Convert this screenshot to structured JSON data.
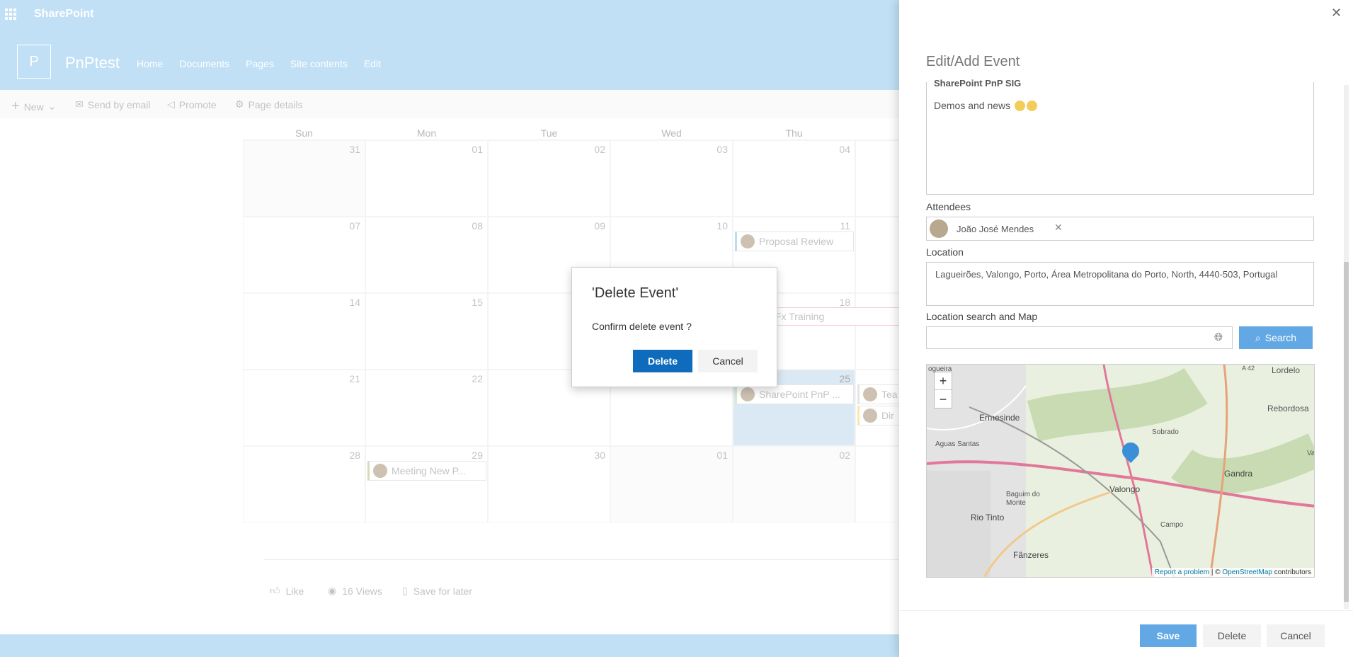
{
  "suite": {
    "brand": "SharePoint"
  },
  "site": {
    "logo_letter": "P",
    "title": "PnPtest",
    "nav": [
      "Home",
      "Documents",
      "Pages",
      "Site contents",
      "Edit"
    ]
  },
  "commands": {
    "new": "New",
    "send": "Send by email",
    "promote": "Promote",
    "details": "Page details"
  },
  "calendar": {
    "weekdays": [
      "Sun",
      "Mon",
      "Tue",
      "Wed",
      "Thu",
      "Fri"
    ],
    "rows": [
      [
        "31",
        "01",
        "02",
        "03",
        "04",
        ""
      ],
      [
        "07",
        "08",
        "09",
        "10",
        "11",
        ""
      ],
      [
        "14",
        "15",
        "",
        "",
        "18",
        ""
      ],
      [
        "21",
        "22",
        "",
        "",
        "25",
        ""
      ],
      [
        "28",
        "29",
        "30",
        "01",
        "02",
        ""
      ]
    ],
    "events": {
      "proposal": "Proposal Review",
      "training": "Fx Training",
      "sharepoint": "SharePoint PnP ...",
      "team": "Tea",
      "dinner": "Dir",
      "meeting": "Meeting New P..."
    }
  },
  "social": {
    "like": "Like",
    "views": "16 Views",
    "save": "Save for later"
  },
  "dialog": {
    "title": "'Delete Event'",
    "message": "Confirm delete event ?",
    "delete": "Delete",
    "cancel": "Cancel"
  },
  "panel": {
    "title": "Edit/Add Event",
    "description_heading": "SharePoint PnP SIG",
    "description_body": "Demos and news",
    "attendees_label": "Attendees",
    "attendee": "João José Mendes",
    "location_label": "Location",
    "location_value": "Lagueirões, Valongo, Porto, Área Metropolitana do Porto, North, 4440-503, Portugal",
    "search_label": "Location search and Map",
    "search_button": "Search",
    "map": {
      "places": [
        "Lordelo",
        "Rebordosa",
        "Ermesinde",
        "Sobrado",
        "Aguas Santas",
        "Gandra",
        "Baguim do Monte",
        "Valongo",
        "Rio Tinto",
        "Campo",
        "Fânzeres",
        "Var",
        "ogueira",
        "A 42"
      ],
      "zoom_in": "+",
      "zoom_out": "−",
      "attribution_report": "Report a problem",
      "attribution_mid": " | © ",
      "attribution_osm": "OpenStreetMap",
      "attribution_end": " contributors"
    },
    "save": "Save",
    "delete": "Delete",
    "cancel": "Cancel"
  }
}
